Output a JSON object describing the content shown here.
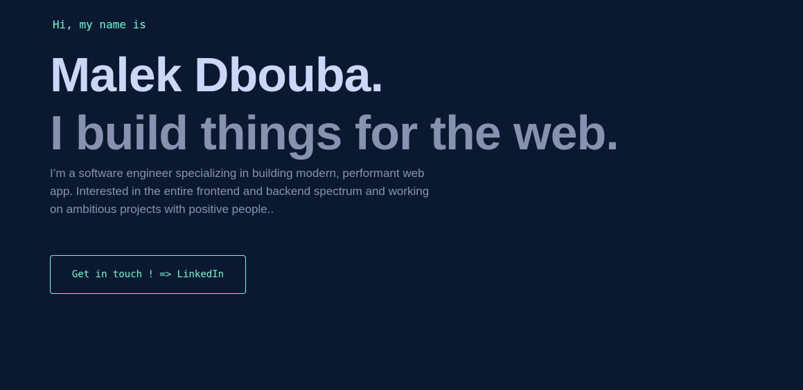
{
  "hero": {
    "overline": "Hi, my name is",
    "name": "Malek Dbouba.",
    "tagline": "I build things for the web.",
    "bio": "I’m a software engineer specializing in building modern, performant web app. Interested in the entire frontend and backend spectrum and working on ambitious projects with positive people..",
    "cta_label": "Get in touch ! => LinkedIn"
  },
  "colors": {
    "background": "#0a192f",
    "accent": "#64ffda",
    "heading": "#ccd6f6",
    "muted": "#8892b0"
  }
}
